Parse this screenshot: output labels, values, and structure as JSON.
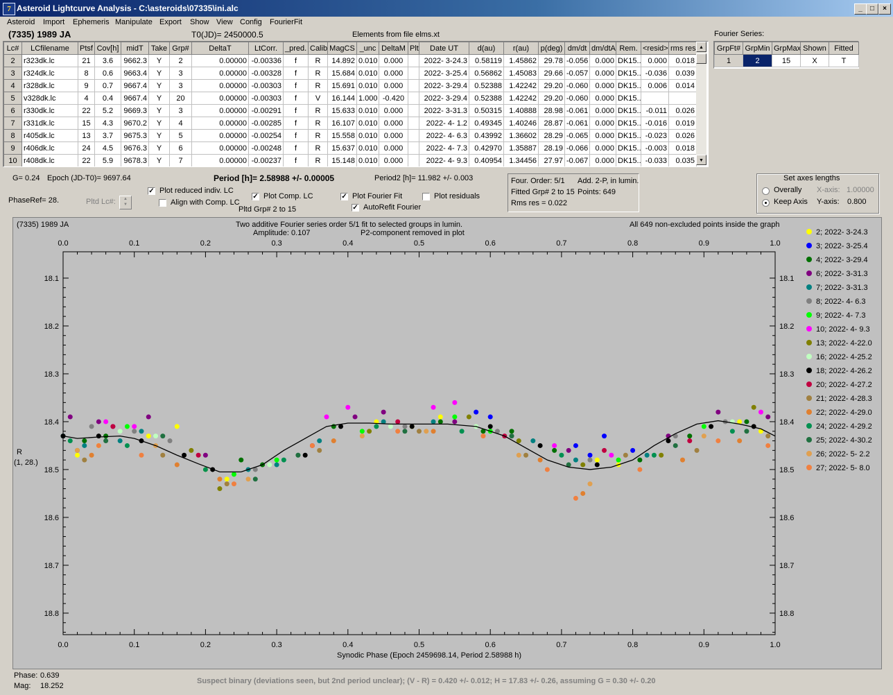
{
  "window": {
    "title": "Asteroid Lightcurve Analysis - C:\\asteroids\\07335\\ini.alc",
    "icon": "app-logo-icon"
  },
  "menu": [
    "Asteroid",
    "Import",
    "Ephemeris",
    "Manipulate",
    "Export",
    "Show",
    "View",
    "Config",
    "FourierFit"
  ],
  "header": {
    "object": "(7335) 1989 JA",
    "t0": "T0(JD)= 2450000.5",
    "elements": "Elements from file elms.xt",
    "fourier_label": "Fourier Series:"
  },
  "lc_table": {
    "columns": [
      "Lc#",
      "LCfilename",
      "Ptsf",
      "Cov[h]",
      "midT",
      "Take",
      "Grp#",
      "DeltaT",
      "LtCorr.",
      "_pred.",
      "Calib.",
      "MagCS",
      "_unc",
      "DeltaM",
      "Plt",
      "Date UT",
      "d(au)",
      "r(au)",
      "p(deg)",
      "dm/dt",
      "dm/dtA",
      "Rem.",
      "<resid>",
      "rms res"
    ],
    "rows": [
      [
        "2",
        "r323dk.lc",
        "21",
        "3.6",
        "9662.3",
        "Y",
        "2",
        "0.00000",
        "-0.00336",
        "f",
        "R",
        "14.892",
        "0.010",
        "0.000",
        "",
        "2022- 3-24.3",
        "0.58119",
        "1.45862",
        "29.78",
        "-0.056",
        "0.000",
        "DK15..",
        "0.000",
        "0.018"
      ],
      [
        "3",
        "r324dk.lc",
        "8",
        "0.6",
        "9663.4",
        "Y",
        "3",
        "0.00000",
        "-0.00328",
        "f",
        "R",
        "15.684",
        "0.010",
        "0.000",
        "",
        "2022- 3-25.4",
        "0.56862",
        "1.45083",
        "29.66",
        "-0.057",
        "0.000",
        "DK15..",
        "-0.036",
        "0.039"
      ],
      [
        "4",
        "r328dk.lc",
        "9",
        "0.7",
        "9667.4",
        "Y",
        "3",
        "0.00000",
        "-0.00303",
        "f",
        "R",
        "15.691",
        "0.010",
        "0.000",
        "",
        "2022- 3-29.4",
        "0.52388",
        "1.42242",
        "29.20",
        "-0.060",
        "0.000",
        "DK15..",
        "0.006",
        "0.014"
      ],
      [
        "5",
        "v328dk.lc",
        "4",
        "0.4",
        "9667.4",
        "Y",
        "20",
        "0.00000",
        "-0.00303",
        "f",
        "V",
        "16.144",
        "1.000",
        "-0.420",
        "",
        "2022- 3-29.4",
        "0.52388",
        "1.42242",
        "29.20",
        "-0.060",
        "0.000",
        "DK15..",
        "",
        ""
      ],
      [
        "6",
        "r330dk.lc",
        "22",
        "5.2",
        "9669.3",
        "Y",
        "3",
        "0.00000",
        "-0.00291",
        "f",
        "R",
        "15.633",
        "0.010",
        "0.000",
        "",
        "2022- 3-31.3",
        "0.50315",
        "1.40888",
        "28.98",
        "-0.061",
        "0.000",
        "DK15..",
        "-0.011",
        "0.026"
      ],
      [
        "7",
        "r331dk.lc",
        "15",
        "4.3",
        "9670.2",
        "Y",
        "4",
        "0.00000",
        "-0.00285",
        "f",
        "R",
        "16.107",
        "0.010",
        "0.000",
        "",
        "2022- 4- 1.2",
        "0.49345",
        "1.40246",
        "28.87",
        "-0.061",
        "0.000",
        "DK15..",
        "-0.016",
        "0.019"
      ],
      [
        "8",
        "r405dk.lc",
        "13",
        "3.7",
        "9675.3",
        "Y",
        "5",
        "0.00000",
        "-0.00254",
        "f",
        "R",
        "15.558",
        "0.010",
        "0.000",
        "",
        "2022- 4- 6.3",
        "0.43992",
        "1.36602",
        "28.29",
        "-0.065",
        "0.000",
        "DK15..",
        "-0.023",
        "0.026"
      ],
      [
        "9",
        "r406dk.lc",
        "24",
        "4.5",
        "9676.3",
        "Y",
        "6",
        "0.00000",
        "-0.00248",
        "f",
        "R",
        "15.637",
        "0.010",
        "0.000",
        "",
        "2022- 4- 7.3",
        "0.42970",
        "1.35887",
        "28.19",
        "-0.066",
        "0.000",
        "DK15..",
        "-0.003",
        "0.018"
      ],
      [
        "10",
        "r408dk.lc",
        "22",
        "5.9",
        "9678.3",
        "Y",
        "7",
        "0.00000",
        "-0.00237",
        "f",
        "R",
        "15.148",
        "0.010",
        "0.000",
        "",
        "2022- 4- 9.3",
        "0.40954",
        "1.34456",
        "27.97",
        "-0.067",
        "0.000",
        "DK15..",
        "-0.033",
        "0.035"
      ]
    ]
  },
  "fourier_table": {
    "columns": [
      "GrpFt#",
      "GrpMin",
      "GrpMax",
      "Shown",
      "Fitted"
    ],
    "row": [
      "1",
      "2",
      "15",
      "X",
      "T"
    ]
  },
  "controls": {
    "g_param": "G= 0.24",
    "epoch": "Epoch (JD-T0)= 9697.64",
    "period": "Period [h]= 2.58988 +/- 0.00005",
    "period2": "Period2 [h]= 11.982 +/- 0.003",
    "phase_ref": "PhaseRef= 28.",
    "pltd_lc": "Pltd Lc#:",
    "plot_reduced": "Plot reduced indiv. LC",
    "align_comp": "Align with Comp. LC",
    "plot_comp": "Plot Comp. LC",
    "pltd_grp": "Pltd Grp#  2   to   15",
    "plot_fourier": "Plot Fourier Fit",
    "autorefit": "AutoRefit Fourier",
    "plot_residuals": "Plot residuals",
    "info_order": "Four. Order:  5/1",
    "info_add": "Add. 2-P, in lumin.",
    "info_fitted": "Fitted Grp# 2 to 15",
    "info_points": "Points: 649",
    "info_rms": "Rms res      = 0.022",
    "axes_title": "Set axes lengths",
    "overally": "Overally",
    "keep_axis": "Keep Axis",
    "x_axis_label": "X-axis:",
    "x_axis_value": "1.00000",
    "y_axis_label": "Y-axis:",
    "y_axis_value": "0.800"
  },
  "plot": {
    "object": "(7335) 1989 JA",
    "line1": "Two additive Fourier series order 5/1 fit to selected groups in lumin.",
    "amplitude": "Amplitude: 0.107",
    "p2_removed": "P2-component removed in plot",
    "all_points": "All 649 non-excluded points inside the graph",
    "ylabel_1": "R",
    "ylabel_2": "(1, 28.)",
    "xlabel": "Synodic Phase (Epoch 2459698.14, Period 2.58988 h)"
  },
  "chart_data": {
    "type": "scatter",
    "title": "Two additive Fourier series order 5/1 fit to selected groups in lumin.",
    "xlabel": "Synodic Phase (Epoch 2459698.14, Period 2.58988 h)",
    "ylabel": "R",
    "xlim": [
      0.0,
      1.0
    ],
    "ylim": [
      18.845,
      18.045
    ],
    "inverted_y": true,
    "grid": false,
    "legend_position": "right",
    "x_ticks": [
      "0.0",
      "0.1",
      "0.2",
      "0.3",
      "0.4",
      "0.5",
      "0.6",
      "0.7",
      "0.8",
      "0.9",
      "1.0"
    ],
    "y_ticks": [
      "18.1",
      "18.2",
      "18.3",
      "18.4",
      "18.5",
      "18.6",
      "18.7",
      "18.8"
    ],
    "fit_curve": {
      "color": "#000000",
      "x": [
        0.0,
        0.02,
        0.05,
        0.08,
        0.1,
        0.13,
        0.16,
        0.19,
        0.22,
        0.25,
        0.28,
        0.31,
        0.34,
        0.37,
        0.4,
        0.43,
        0.46,
        0.5,
        0.54,
        0.58,
        0.62,
        0.65,
        0.68,
        0.71,
        0.74,
        0.77,
        0.8,
        0.83,
        0.86,
        0.89,
        0.92,
        0.95,
        0.98,
        1.0
      ],
      "y": [
        18.43,
        18.435,
        18.432,
        18.43,
        18.435,
        18.45,
        18.47,
        18.488,
        18.505,
        18.505,
        18.49,
        18.46,
        18.435,
        18.41,
        18.403,
        18.403,
        18.405,
        18.405,
        18.405,
        18.41,
        18.43,
        18.455,
        18.48,
        18.495,
        18.5,
        18.495,
        18.48,
        18.45,
        18.425,
        18.405,
        18.398,
        18.405,
        18.415,
        18.43
      ]
    },
    "series": [
      {
        "name": "2; 2022- 3-24.3",
        "color": "#ffff00",
        "x": [
          0.02,
          0.05,
          0.12,
          0.16,
          0.2,
          0.23,
          0.44,
          0.49,
          0.53,
          0.75,
          0.78,
          0.95,
          0.98
        ],
        "y": [
          18.47,
          18.45,
          18.43,
          18.41,
          18.5,
          18.52,
          18.4,
          18.41,
          18.39,
          18.48,
          18.49,
          18.4,
          18.42
        ]
      },
      {
        "name": "3; 2022- 3-25.4",
        "color": "#0000ff",
        "x": [
          0.58,
          0.6,
          0.72,
          0.74,
          0.76,
          0.8
        ],
        "y": [
          18.38,
          18.39,
          18.45,
          18.47,
          18.43,
          18.46
        ]
      },
      {
        "name": "4; 2022- 3-29.4",
        "color": "#007000",
        "x": [
          0.03,
          0.06,
          0.25,
          0.28,
          0.38,
          0.53,
          0.59,
          0.63,
          0.69,
          0.81,
          0.88,
          0.96
        ],
        "y": [
          18.44,
          18.43,
          18.48,
          18.49,
          18.41,
          18.4,
          18.42,
          18.42,
          18.46,
          18.48,
          18.43,
          18.4
        ]
      },
      {
        "name": "6; 2022- 3-31.3",
        "color": "#800080",
        "x": [
          0.01,
          0.05,
          0.07,
          0.12,
          0.2,
          0.41,
          0.45,
          0.55,
          0.71,
          0.85,
          0.92,
          0.99
        ],
        "y": [
          18.39,
          18.4,
          18.41,
          18.39,
          18.47,
          18.39,
          18.38,
          18.4,
          18.46,
          18.43,
          18.38,
          18.39
        ]
      },
      {
        "name": "7; 2022- 3-31.3",
        "color": "#008080",
        "x": [
          0.0,
          0.03,
          0.08,
          0.11,
          0.26,
          0.3,
          0.36,
          0.45,
          0.52,
          0.66,
          0.72,
          0.82
        ],
        "y": [
          18.43,
          18.45,
          18.44,
          18.42,
          18.5,
          18.49,
          18.44,
          18.4,
          18.4,
          18.44,
          18.48,
          18.47
        ]
      },
      {
        "name": "8; 2022- 4- 6.3",
        "color": "#808080",
        "x": [
          0.04,
          0.1,
          0.15,
          0.27,
          0.33,
          0.48,
          0.61,
          0.74,
          0.86,
          0.93
        ],
        "y": [
          18.41,
          18.42,
          18.44,
          18.5,
          18.47,
          18.41,
          18.42,
          18.48,
          18.43,
          18.4
        ]
      },
      {
        "name": "9; 2022- 4- 7.3",
        "color": "#00ff00",
        "x": [
          0.09,
          0.24,
          0.3,
          0.42,
          0.55,
          0.6,
          0.78,
          0.9
        ],
        "y": [
          18.41,
          18.51,
          18.48,
          18.42,
          18.39,
          18.42,
          18.48,
          18.41
        ]
      },
      {
        "name": "10; 2022- 4- 9.3",
        "color": "#ff00ff",
        "x": [
          0.06,
          0.1,
          0.37,
          0.4,
          0.52,
          0.55,
          0.69,
          0.77,
          0.98
        ],
        "y": [
          18.4,
          18.41,
          18.39,
          18.37,
          18.37,
          18.36,
          18.45,
          18.47,
          18.38
        ]
      },
      {
        "name": "13; 2022- 4-22.0",
        "color": "#808000",
        "x": [
          0.02,
          0.18,
          0.22,
          0.43,
          0.57,
          0.64,
          0.73,
          0.84,
          0.97
        ],
        "y": [
          18.46,
          18.46,
          18.54,
          18.42,
          18.39,
          18.44,
          18.49,
          18.47,
          18.37
        ]
      },
      {
        "name": "16; 2022- 4-25.2",
        "color": "#c0ffc0",
        "x": [
          0.08,
          0.13,
          0.29,
          0.46,
          0.58,
          0.94
        ],
        "y": [
          18.42,
          18.43,
          18.49,
          18.41,
          18.41,
          18.4
        ]
      },
      {
        "name": "18; 2022- 4-26.2",
        "color": "#000000",
        "x": [
          0.0,
          0.05,
          0.11,
          0.17,
          0.21,
          0.34,
          0.39,
          0.49,
          0.6,
          0.67,
          0.75,
          0.85,
          0.91,
          0.97
        ],
        "y": [
          18.43,
          18.43,
          18.44,
          18.47,
          18.5,
          18.47,
          18.41,
          18.41,
          18.41,
          18.45,
          18.49,
          18.44,
          18.41,
          18.41
        ]
      },
      {
        "name": "20; 2022- 4-27.2",
        "color": "#c00040",
        "x": [
          0.07,
          0.19,
          0.35,
          0.47,
          0.62,
          0.76,
          0.88
        ],
        "y": [
          18.41,
          18.47,
          18.45,
          18.4,
          18.43,
          18.46,
          18.44
        ]
      },
      {
        "name": "21; 2022- 4-28.3",
        "color": "#a08040",
        "x": [
          0.03,
          0.14,
          0.23,
          0.36,
          0.5,
          0.65,
          0.79,
          0.89,
          0.99
        ],
        "y": [
          18.48,
          18.47,
          18.53,
          18.46,
          18.42,
          18.47,
          18.47,
          18.46,
          18.43
        ]
      },
      {
        "name": "22; 2022- 4-29.0",
        "color": "#e08030",
        "x": [
          0.04,
          0.16,
          0.22,
          0.38,
          0.52,
          0.67,
          0.73,
          0.87,
          0.95
        ],
        "y": [
          18.47,
          18.49,
          18.52,
          18.44,
          18.42,
          18.48,
          18.55,
          18.48,
          18.44
        ]
      },
      {
        "name": "24; 2022- 4-29.2",
        "color": "#009050",
        "x": [
          0.01,
          0.09,
          0.2,
          0.31,
          0.44,
          0.56,
          0.7,
          0.83,
          0.94
        ],
        "y": [
          18.44,
          18.45,
          18.5,
          18.48,
          18.41,
          18.42,
          18.47,
          18.47,
          18.42
        ]
      },
      {
        "name": "25; 2022- 4-30.2",
        "color": "#207040",
        "x": [
          0.06,
          0.14,
          0.27,
          0.33,
          0.48,
          0.63,
          0.71,
          0.86,
          0.96
        ],
        "y": [
          18.44,
          18.43,
          18.52,
          18.47,
          18.42,
          18.43,
          18.49,
          18.45,
          18.42
        ]
      },
      {
        "name": "26; 2022- 5- 2.2",
        "color": "#e0a050",
        "x": [
          0.02,
          0.13,
          0.26,
          0.42,
          0.51,
          0.64,
          0.74,
          0.9
        ],
        "y": [
          18.46,
          18.45,
          18.52,
          18.43,
          18.42,
          18.47,
          18.53,
          18.43
        ]
      },
      {
        "name": "27; 2022- 5- 8.0",
        "color": "#f08040",
        "x": [
          0.05,
          0.11,
          0.24,
          0.35,
          0.47,
          0.59,
          0.68,
          0.72,
          0.81,
          0.92,
          0.99
        ],
        "y": [
          18.45,
          18.47,
          18.53,
          18.45,
          18.42,
          18.43,
          18.5,
          18.56,
          18.5,
          18.44,
          18.45
        ]
      }
    ]
  },
  "readout": {
    "phase_label": "Phase:",
    "phase_value": "0.639",
    "mag_label": "Mag:",
    "mag_value": "18.252"
  },
  "status_text": "Suspect binary (deviations seen, but 2nd period unclear); (V - R) = 0.420 +/- 0.012; H = 17.83 +/- 0.26, assuming G = 0.30 +/- 0.20"
}
